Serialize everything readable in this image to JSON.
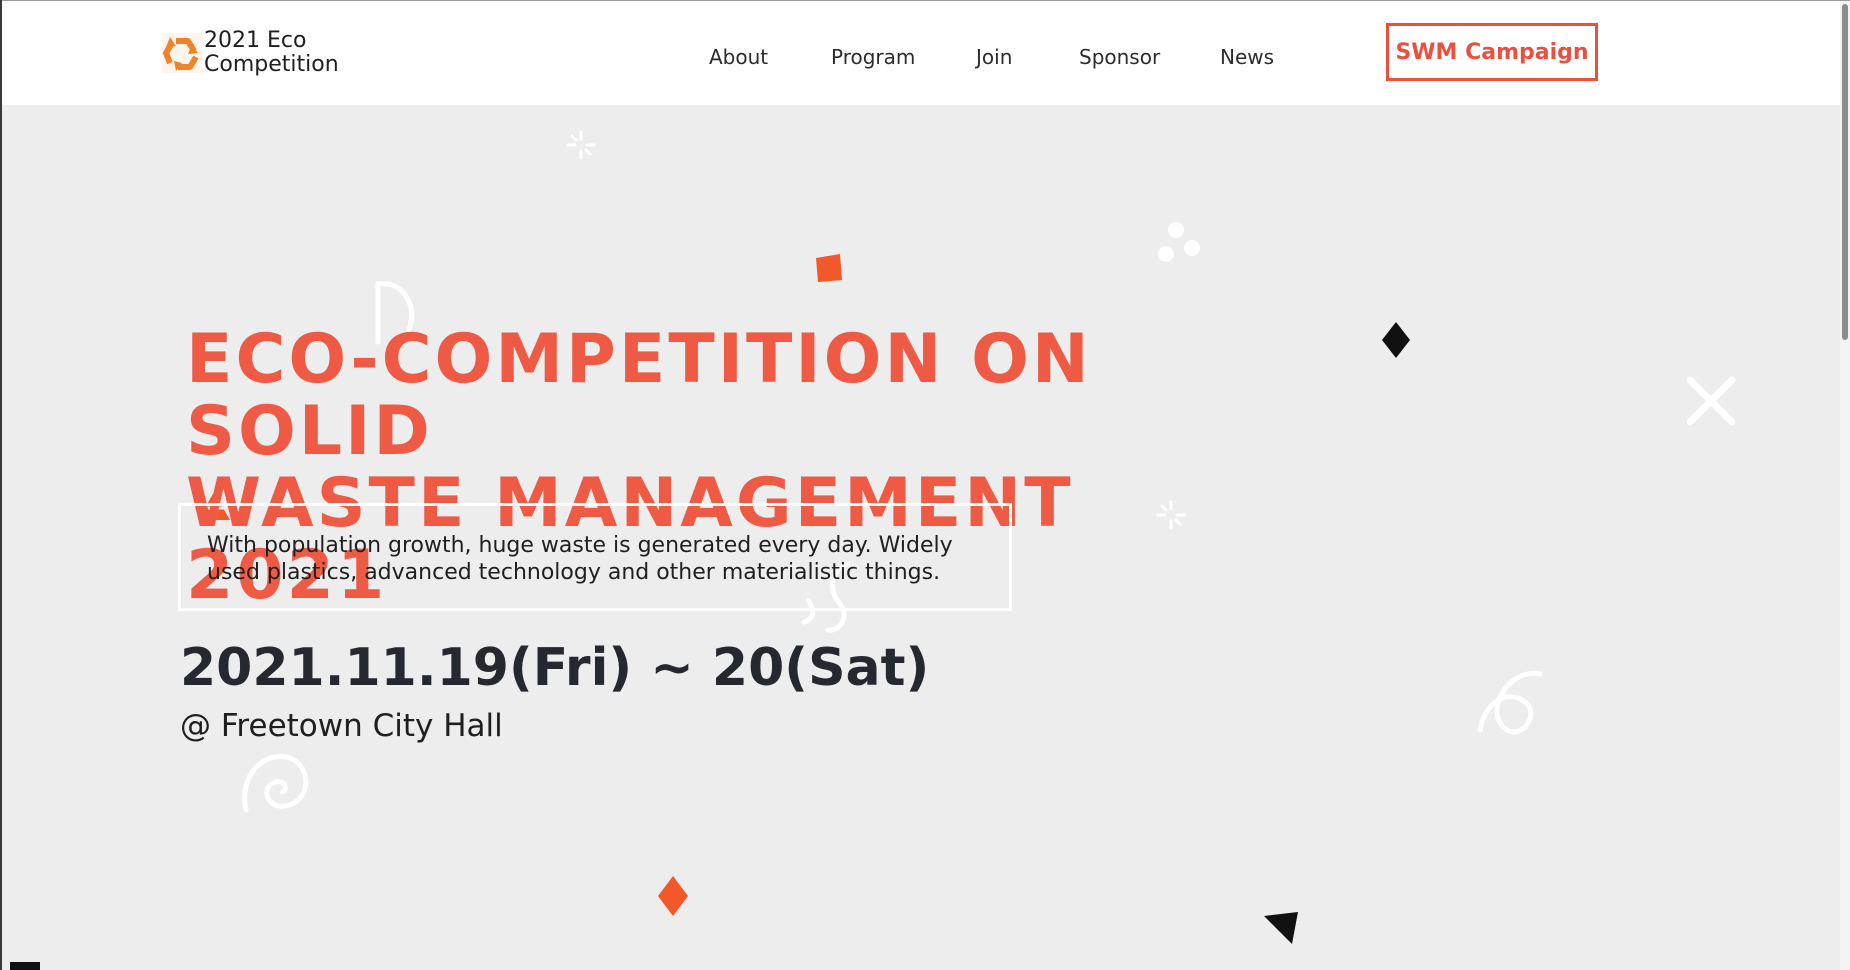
{
  "brand": {
    "name": "2021 Eco Competition",
    "line1": "2021 Eco",
    "line2": "Competition",
    "icon": "recycle-icon",
    "icon_color": "#f0822a"
  },
  "nav": {
    "items": [
      {
        "label": "About"
      },
      {
        "label": "Program"
      },
      {
        "label": "Join"
      },
      {
        "label": "Sponsor"
      },
      {
        "label": "News"
      }
    ],
    "cta_label": "SWM Campaign"
  },
  "hero": {
    "title_line1": "ECO-COMPETITION ON SOLID",
    "title_line2": "WASTE MANAGEMENT 2021",
    "description": "With population growth, huge waste is generated every day. Widely used plastics, advanced technology and other materialistic things.",
    "date": "2021.11.19(Fri) ~ 20(Sat)",
    "venue": "@ Freetown City Hall"
  },
  "colors": {
    "accent": "#ef5a45",
    "cta_border": "#e9503f",
    "background": "#ededed",
    "header_bg": "#ffffff",
    "date_text": "#262830",
    "confetti_orange": "#f2582a",
    "confetti_black": "#111111",
    "confetti_white": "#ffffff"
  },
  "decorations": [
    "sparkle-icon",
    "dots-icon",
    "square-confetti",
    "arc-squiggle",
    "diamond-confetti",
    "x-confetti",
    "triangle-confetti",
    "spiral-squiggle",
    "loop-squiggle",
    "s-squiggle"
  ]
}
